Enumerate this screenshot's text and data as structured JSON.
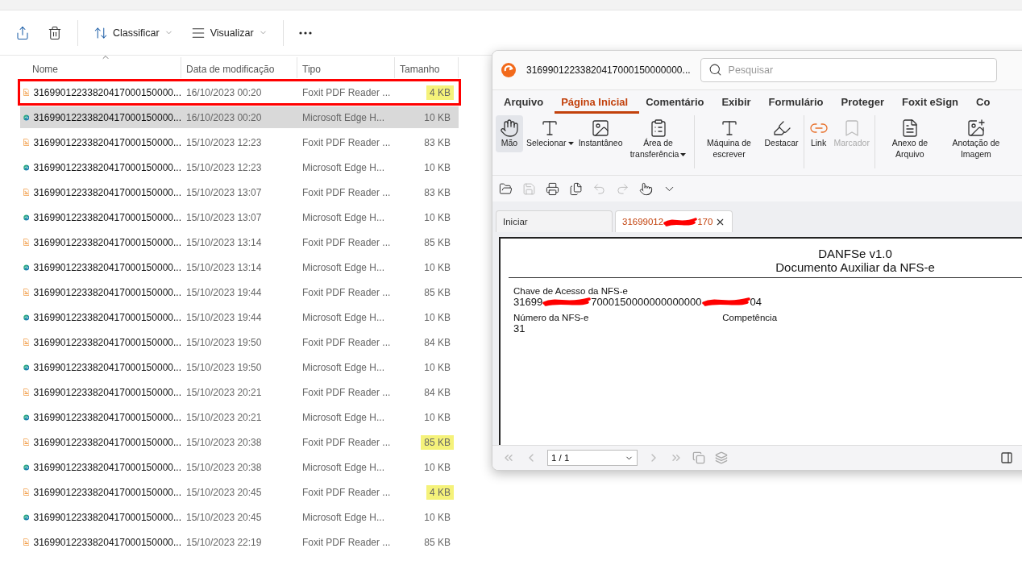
{
  "explorer": {
    "toolbar": [
      {
        "kind": "share"
      },
      {
        "kind": "delete"
      },
      {
        "kind": "sort",
        "label": "Classificar"
      },
      {
        "kind": "view",
        "label": "Visualizar"
      },
      {
        "kind": "more"
      }
    ],
    "columns": [
      {
        "label": "Nome",
        "sorted": true
      },
      {
        "label": "Data de modificação",
        "sorted": false
      },
      {
        "label": "Tipo",
        "sorted": false
      },
      {
        "label": "Tamanho",
        "sorted": false
      }
    ],
    "rows": [
      {
        "kind": "pdf",
        "name": "31699012233820417000150000...",
        "date": "16/10/2023 00:20",
        "type": "Foxit PDF Reader ...",
        "size": "4 KB",
        "selected": false,
        "highlighted": true,
        "outlined": true
      },
      {
        "kind": "html",
        "name": "31699012233820417000150000...",
        "date": "16/10/2023 00:20",
        "type": "Microsoft Edge H...",
        "size": "10 KB",
        "selected": true,
        "highlighted": false,
        "outlined": false
      },
      {
        "kind": "pdf",
        "name": "31699012233820417000150000...",
        "date": "15/10/2023 12:23",
        "type": "Foxit PDF Reader ...",
        "size": "83 KB",
        "selected": false,
        "highlighted": false,
        "outlined": false
      },
      {
        "kind": "html",
        "name": "31699012233820417000150000...",
        "date": "15/10/2023 12:23",
        "type": "Microsoft Edge H...",
        "size": "10 KB",
        "selected": false,
        "highlighted": false,
        "outlined": false
      },
      {
        "kind": "pdf",
        "name": "31699012233820417000150000...",
        "date": "15/10/2023 13:07",
        "type": "Foxit PDF Reader ...",
        "size": "83 KB",
        "selected": false,
        "highlighted": false,
        "outlined": false
      },
      {
        "kind": "html",
        "name": "31699012233820417000150000...",
        "date": "15/10/2023 13:07",
        "type": "Microsoft Edge H...",
        "size": "10 KB",
        "selected": false,
        "highlighted": false,
        "outlined": false
      },
      {
        "kind": "pdf",
        "name": "31699012233820417000150000...",
        "date": "15/10/2023 13:14",
        "type": "Foxit PDF Reader ...",
        "size": "85 KB",
        "selected": false,
        "highlighted": false,
        "outlined": false
      },
      {
        "kind": "html",
        "name": "31699012233820417000150000...",
        "date": "15/10/2023 13:14",
        "type": "Microsoft Edge H...",
        "size": "10 KB",
        "selected": false,
        "highlighted": false,
        "outlined": false
      },
      {
        "kind": "pdf",
        "name": "31699012233820417000150000...",
        "date": "15/10/2023 19:44",
        "type": "Foxit PDF Reader ...",
        "size": "85 KB",
        "selected": false,
        "highlighted": false,
        "outlined": false
      },
      {
        "kind": "html",
        "name": "31699012233820417000150000...",
        "date": "15/10/2023 19:44",
        "type": "Microsoft Edge H...",
        "size": "10 KB",
        "selected": false,
        "highlighted": false,
        "outlined": false
      },
      {
        "kind": "pdf",
        "name": "31699012233820417000150000...",
        "date": "15/10/2023 19:50",
        "type": "Foxit PDF Reader ...",
        "size": "84 KB",
        "selected": false,
        "highlighted": false,
        "outlined": false
      },
      {
        "kind": "html",
        "name": "31699012233820417000150000...",
        "date": "15/10/2023 19:50",
        "type": "Microsoft Edge H...",
        "size": "10 KB",
        "selected": false,
        "highlighted": false,
        "outlined": false
      },
      {
        "kind": "pdf",
        "name": "31699012233820417000150000...",
        "date": "15/10/2023 20:21",
        "type": "Foxit PDF Reader ...",
        "size": "84 KB",
        "selected": false,
        "highlighted": false,
        "outlined": false
      },
      {
        "kind": "html",
        "name": "31699012233820417000150000...",
        "date": "15/10/2023 20:21",
        "type": "Microsoft Edge H...",
        "size": "10 KB",
        "selected": false,
        "highlighted": false,
        "outlined": false
      },
      {
        "kind": "pdf",
        "name": "31699012233820417000150000...",
        "date": "15/10/2023 20:38",
        "type": "Foxit PDF Reader ...",
        "size": "85 KB",
        "selected": false,
        "highlighted": true,
        "outlined": false
      },
      {
        "kind": "html",
        "name": "31699012233820417000150000...",
        "date": "15/10/2023 20:38",
        "type": "Microsoft Edge H...",
        "size": "10 KB",
        "selected": false,
        "highlighted": false,
        "outlined": false
      },
      {
        "kind": "pdf",
        "name": "31699012233820417000150000...",
        "date": "15/10/2023 20:45",
        "type": "Foxit PDF Reader ...",
        "size": "4 KB",
        "selected": false,
        "highlighted": true,
        "outlined": false
      },
      {
        "kind": "html",
        "name": "31699012233820417000150000...",
        "date": "15/10/2023 20:45",
        "type": "Microsoft Edge H...",
        "size": "10 KB",
        "selected": false,
        "highlighted": false,
        "outlined": false
      },
      {
        "kind": "pdf",
        "name": "31699012233820417000150000...",
        "date": "15/10/2023 22:19",
        "type": "Foxit PDF Reader ...",
        "size": "85 KB",
        "selected": false,
        "highlighted": false,
        "outlined": false
      }
    ]
  },
  "foxit": {
    "title": "31699012233820417000150000000...",
    "search": {
      "placeholder": "Pesquisar"
    },
    "menu": [
      {
        "label": "Arquivo",
        "selected": false
      },
      {
        "label": "Página Inicial",
        "selected": true
      },
      {
        "label": "Comentário",
        "selected": false
      },
      {
        "label": "Exibir",
        "selected": false
      },
      {
        "label": "Formulário",
        "selected": false
      },
      {
        "label": "Proteger",
        "selected": false
      },
      {
        "label": "Foxit eSign",
        "selected": false
      },
      {
        "label": "Co",
        "selected": false
      }
    ],
    "ribbon": [
      {
        "kind": "hand",
        "label": "Mão",
        "selected": true,
        "disabled": false,
        "dropdown": false,
        "separator_before": false
      },
      {
        "kind": "select",
        "label": "Selecionar",
        "selected": false,
        "disabled": false,
        "dropdown": true,
        "separator_before": false
      },
      {
        "kind": "snapshot",
        "label": "Instantâneo",
        "selected": false,
        "disabled": false,
        "dropdown": false,
        "separator_before": false
      },
      {
        "kind": "clipboard",
        "label": "Área de transferência",
        "selected": false,
        "disabled": false,
        "dropdown": true,
        "separator_before": false
      },
      {
        "kind": "typewriter",
        "label": "Máquina de escrever",
        "selected": false,
        "disabled": false,
        "dropdown": false,
        "separator_before": true
      },
      {
        "kind": "highlight",
        "label": "Destacar",
        "selected": false,
        "disabled": false,
        "dropdown": false,
        "separator_before": false
      },
      {
        "kind": "link",
        "label": "Link",
        "selected": false,
        "disabled": false,
        "dropdown": false,
        "separator_before": true
      },
      {
        "kind": "bookmark",
        "label": "Marcador",
        "selected": false,
        "disabled": true,
        "dropdown": false,
        "separator_before": false
      },
      {
        "kind": "attachment",
        "label": "Anexo de Arquivo",
        "selected": false,
        "disabled": false,
        "dropdown": false,
        "separator_before": true
      },
      {
        "kind": "image",
        "label": "Anotação de Imagem",
        "selected": false,
        "disabled": false,
        "dropdown": false,
        "separator_before": false
      }
    ],
    "quick_tools": [
      {
        "kind": "open",
        "disabled": false
      },
      {
        "kind": "save",
        "disabled": true
      },
      {
        "kind": "print",
        "disabled": false
      },
      {
        "kind": "pages",
        "disabled": false
      },
      {
        "kind": "undo",
        "disabled": true
      },
      {
        "kind": "redo",
        "disabled": true
      },
      {
        "kind": "pointer",
        "disabled": false
      },
      {
        "kind": "customize",
        "disabled": false
      }
    ],
    "tabs": [
      {
        "label": "Iniciar",
        "selected": false,
        "redacted": false
      },
      {
        "label": "31699012",
        "label_end": "170",
        "selected": true,
        "redacted": true
      }
    ],
    "document": {
      "title": "DANFSe v1.0",
      "subtitle": "Documento Auxiliar da NFS-e",
      "key_label": "Chave de Acesso da NFS-e",
      "key_parts": [
        "31699",
        "7000150000000000000",
        "04"
      ],
      "fields": [
        {
          "label": "Número da NFS-e",
          "value": "31"
        },
        {
          "label": "Competência"
        }
      ]
    },
    "page_field": "1 / 1"
  }
}
